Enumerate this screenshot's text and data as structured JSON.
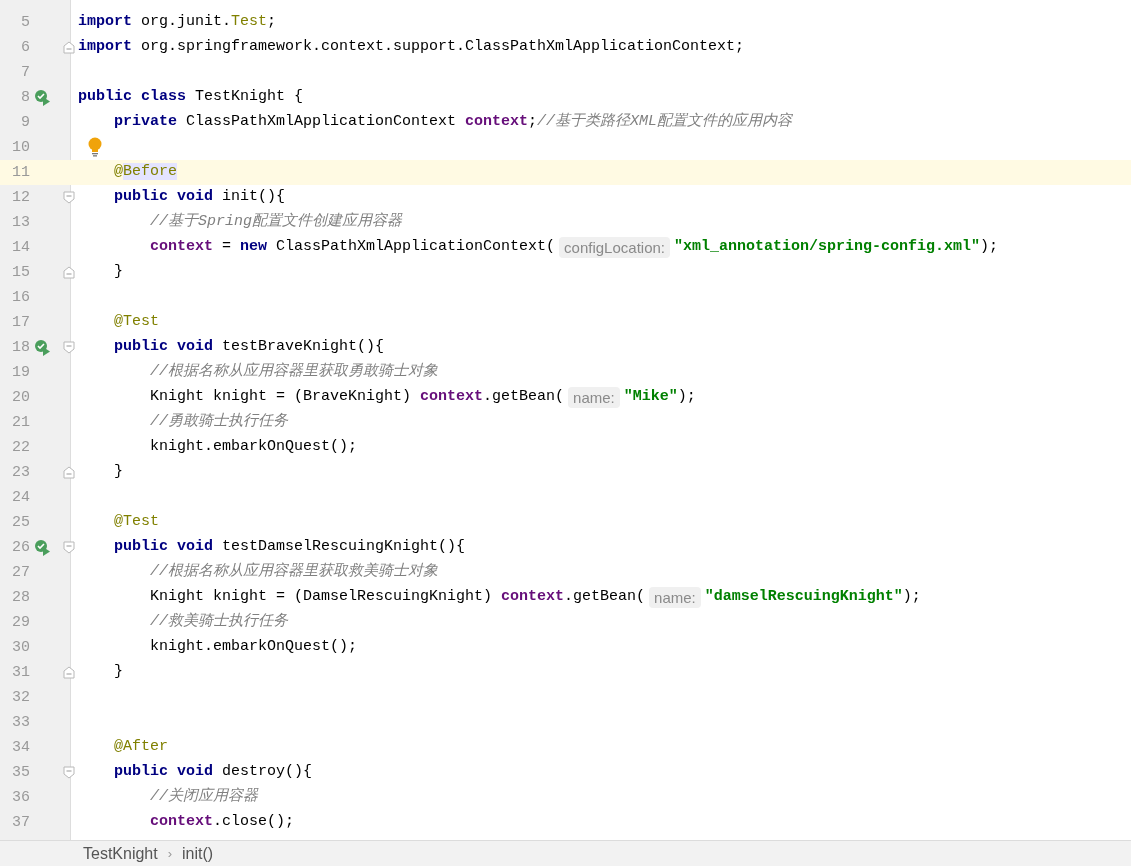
{
  "editor": {
    "lines": [
      {
        "number": "5",
        "current": false,
        "kind": "top",
        "tokens": [
          {
            "text": "import",
            "kind": "kw"
          },
          {
            "text": " org.junit.",
            "kind": "plain"
          },
          {
            "text": "Test",
            "kind": "anno"
          },
          {
            "text": ";",
            "kind": "plain"
          }
        ]
      },
      {
        "number": "6",
        "current": false,
        "kind": "top",
        "fold_end": true,
        "tokens": [
          {
            "text": "import",
            "kind": "kw"
          },
          {
            "text": " org.springframework.context.support.ClassPathXmlApplicationContext;",
            "kind": "plain"
          }
        ]
      },
      {
        "number": "7",
        "current": false,
        "kind": "top"
      },
      {
        "number": "8",
        "current": false,
        "kind": "top",
        "run_icon": true,
        "tokens": [
          {
            "text": "public class",
            "kind": "kw"
          },
          {
            "text": " TestKnight {",
            "kind": "plain"
          }
        ]
      },
      {
        "number": "9",
        "current": false,
        "kind": "member",
        "tokens": [
          {
            "text": "private",
            "kind": "kw"
          },
          {
            "text": " ClassPathXmlApplicationContext ",
            "kind": "plain"
          },
          {
            "text": "context",
            "kind": "field"
          },
          {
            "text": ";",
            "kind": "plain"
          },
          {
            "text": "//基于类路径XML配置文件的应用内容",
            "kind": "comment"
          }
        ]
      },
      {
        "number": "10",
        "current": false,
        "kind": "top",
        "bulb": true
      },
      {
        "number": "11",
        "current": true,
        "kind": "member",
        "tokens": [
          {
            "text": "@",
            "kind": "anno"
          },
          {
            "text": "Before",
            "kind": "anno_hl"
          }
        ]
      },
      {
        "number": "12",
        "current": false,
        "kind": "member",
        "fold_start": true,
        "tokens": [
          {
            "text": "public void",
            "kind": "kw"
          },
          {
            "text": " init(){",
            "kind": "plain"
          }
        ]
      },
      {
        "number": "13",
        "current": false,
        "kind": "body",
        "tokens": [
          {
            "text": "//基于Spring配置文件创建应用容器",
            "kind": "comment"
          }
        ]
      },
      {
        "number": "14",
        "current": false,
        "kind": "body",
        "tokens": [
          {
            "text": "context",
            "kind": "field"
          },
          {
            "text": " = ",
            "kind": "plain"
          },
          {
            "text": "new",
            "kind": "kw"
          },
          {
            "text": " ClassPathXmlApplicationContext(",
            "kind": "plain"
          },
          {
            "text": "configLocation:",
            "kind": "hint"
          },
          {
            "text": "\"xml_annotation/spring-config.xml\"",
            "kind": "string"
          },
          {
            "text": ");",
            "kind": "plain"
          }
        ]
      },
      {
        "number": "15",
        "current": false,
        "kind": "member",
        "fold_end": true,
        "tokens": [
          {
            "text": "}",
            "kind": "plain"
          }
        ]
      },
      {
        "number": "16",
        "current": false,
        "kind": "top"
      },
      {
        "number": "17",
        "current": false,
        "kind": "member",
        "tokens": [
          {
            "text": "@Test",
            "kind": "anno"
          }
        ]
      },
      {
        "number": "18",
        "current": false,
        "kind": "member",
        "run_icon": true,
        "fold_start": true,
        "tokens": [
          {
            "text": "public void",
            "kind": "kw"
          },
          {
            "text": " testBraveKnight(){",
            "kind": "plain"
          }
        ]
      },
      {
        "number": "19",
        "current": false,
        "kind": "body",
        "tokens": [
          {
            "text": "//根据名称从应用容器里获取勇敢骑士对象",
            "kind": "comment"
          }
        ]
      },
      {
        "number": "20",
        "current": false,
        "kind": "body",
        "tokens": [
          {
            "text": "Knight knight = (BraveKnight) ",
            "kind": "plain"
          },
          {
            "text": "context",
            "kind": "field"
          },
          {
            "text": ".getBean(",
            "kind": "plain"
          },
          {
            "text": "name:",
            "kind": "hint"
          },
          {
            "text": "\"Mike\"",
            "kind": "string"
          },
          {
            "text": ");",
            "kind": "plain"
          }
        ]
      },
      {
        "number": "21",
        "current": false,
        "kind": "body",
        "tokens": [
          {
            "text": "//勇敢骑士执行任务",
            "kind": "comment"
          }
        ]
      },
      {
        "number": "22",
        "current": false,
        "kind": "body",
        "tokens": [
          {
            "text": "knight.embarkOnQuest();",
            "kind": "plain"
          }
        ]
      },
      {
        "number": "23",
        "current": false,
        "kind": "member",
        "fold_end": true,
        "tokens": [
          {
            "text": "}",
            "kind": "plain"
          }
        ]
      },
      {
        "number": "24",
        "current": false,
        "kind": "top"
      },
      {
        "number": "25",
        "current": false,
        "kind": "member",
        "tokens": [
          {
            "text": "@Test",
            "kind": "anno"
          }
        ]
      },
      {
        "number": "26",
        "current": false,
        "kind": "member",
        "run_icon": true,
        "fold_start": true,
        "tokens": [
          {
            "text": "public void",
            "kind": "kw"
          },
          {
            "text": " testDamselRescuingKnight(){",
            "kind": "plain"
          }
        ]
      },
      {
        "number": "27",
        "current": false,
        "kind": "body",
        "tokens": [
          {
            "text": "//根据名称从应用容器里获取救美骑士对象",
            "kind": "comment"
          }
        ]
      },
      {
        "number": "28",
        "current": false,
        "kind": "body",
        "tokens": [
          {
            "text": "Knight knight = (DamselRescuingKnight) ",
            "kind": "plain"
          },
          {
            "text": "context",
            "kind": "field"
          },
          {
            "text": ".getBean(",
            "kind": "plain"
          },
          {
            "text": "name:",
            "kind": "hint"
          },
          {
            "text": "\"damselRescuingKnight\"",
            "kind": "string"
          },
          {
            "text": ");",
            "kind": "plain"
          }
        ]
      },
      {
        "number": "29",
        "current": false,
        "kind": "body",
        "tokens": [
          {
            "text": "//救美骑士执行任务",
            "kind": "comment"
          }
        ]
      },
      {
        "number": "30",
        "current": false,
        "kind": "body",
        "tokens": [
          {
            "text": "knight.embarkOnQuest();",
            "kind": "plain"
          }
        ]
      },
      {
        "number": "31",
        "current": false,
        "kind": "member",
        "fold_end": true,
        "tokens": [
          {
            "text": "}",
            "kind": "plain"
          }
        ]
      },
      {
        "number": "32",
        "current": false,
        "kind": "top"
      },
      {
        "number": "33",
        "current": false,
        "kind": "top"
      },
      {
        "number": "34",
        "current": false,
        "kind": "member",
        "tokens": [
          {
            "text": "@After",
            "kind": "anno"
          }
        ]
      },
      {
        "number": "35",
        "current": false,
        "kind": "member",
        "fold_start": true,
        "tokens": [
          {
            "text": "public void",
            "kind": "kw"
          },
          {
            "text": " destroy(){",
            "kind": "plain"
          }
        ]
      },
      {
        "number": "36",
        "current": false,
        "kind": "body",
        "tokens": [
          {
            "text": "//关闭应用容器",
            "kind": "comment"
          }
        ]
      },
      {
        "number": "37",
        "current": false,
        "kind": "body",
        "tokens": [
          {
            "text": "context",
            "kind": "field"
          },
          {
            "text": ".close();",
            "kind": "plain"
          }
        ]
      }
    ]
  },
  "breadcrumbs": [
    {
      "text": "TestKnight"
    },
    {
      "text": "init()"
    }
  ],
  "breadcrumb_separator": "›"
}
